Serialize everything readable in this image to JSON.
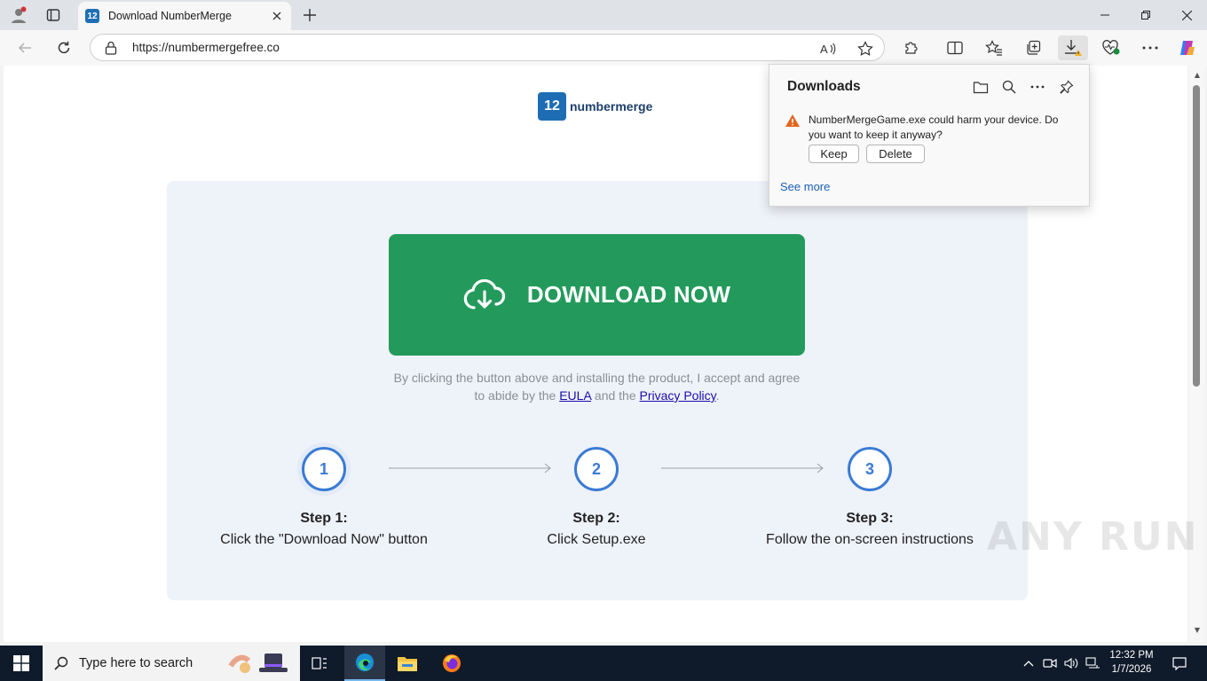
{
  "browser": {
    "tab": {
      "favicon": "12",
      "title": "Download NumberMerge"
    },
    "address": {
      "url": "https://numbermergefree.co"
    },
    "icons": {
      "profile": "profile-icon",
      "tabs": "tab-actions-icon",
      "read_aloud": "read-aloud-icon",
      "favorite": "star-icon",
      "extensions": "puzzle-icon",
      "split": "split-screen-icon",
      "favorites": "favorites-icon",
      "collections": "collections-icon",
      "downloads": "download-icon",
      "performance": "heart-pulse-icon",
      "menu": "more-icon",
      "copilot": "copilot-icon"
    }
  },
  "page": {
    "logo": {
      "mark": "12",
      "name": "numbermerge"
    },
    "download_button": {
      "label": "DOWNLOAD NOW",
      "color": "#239a5b"
    },
    "terms": {
      "before": "By clicking the button above and installing the product, I accept and agree to abide by the ",
      "eula": "EULA",
      "middle": " and the ",
      "privacy": "Privacy Policy",
      "after": "."
    },
    "steps": [
      {
        "number": "1",
        "title": "Step 1:",
        "text": "Click the \"Download Now\" button"
      },
      {
        "number": "2",
        "title": "Step 2:",
        "text": "Click Setup.exe"
      },
      {
        "number": "3",
        "title": "Step 3:",
        "text": "Follow the on-screen instructions"
      }
    ]
  },
  "downloads_flyout": {
    "title": "Downloads",
    "message": "NumberMergeGame.exe could harm your device. Do you want to keep it anyway?",
    "keep": "Keep",
    "delete": "Delete",
    "see_more": "See more"
  },
  "taskbar": {
    "search_placeholder": "Type here to search",
    "time": "12:32 PM",
    "date": "1/7/2026"
  },
  "watermark": "ANY RUN"
}
